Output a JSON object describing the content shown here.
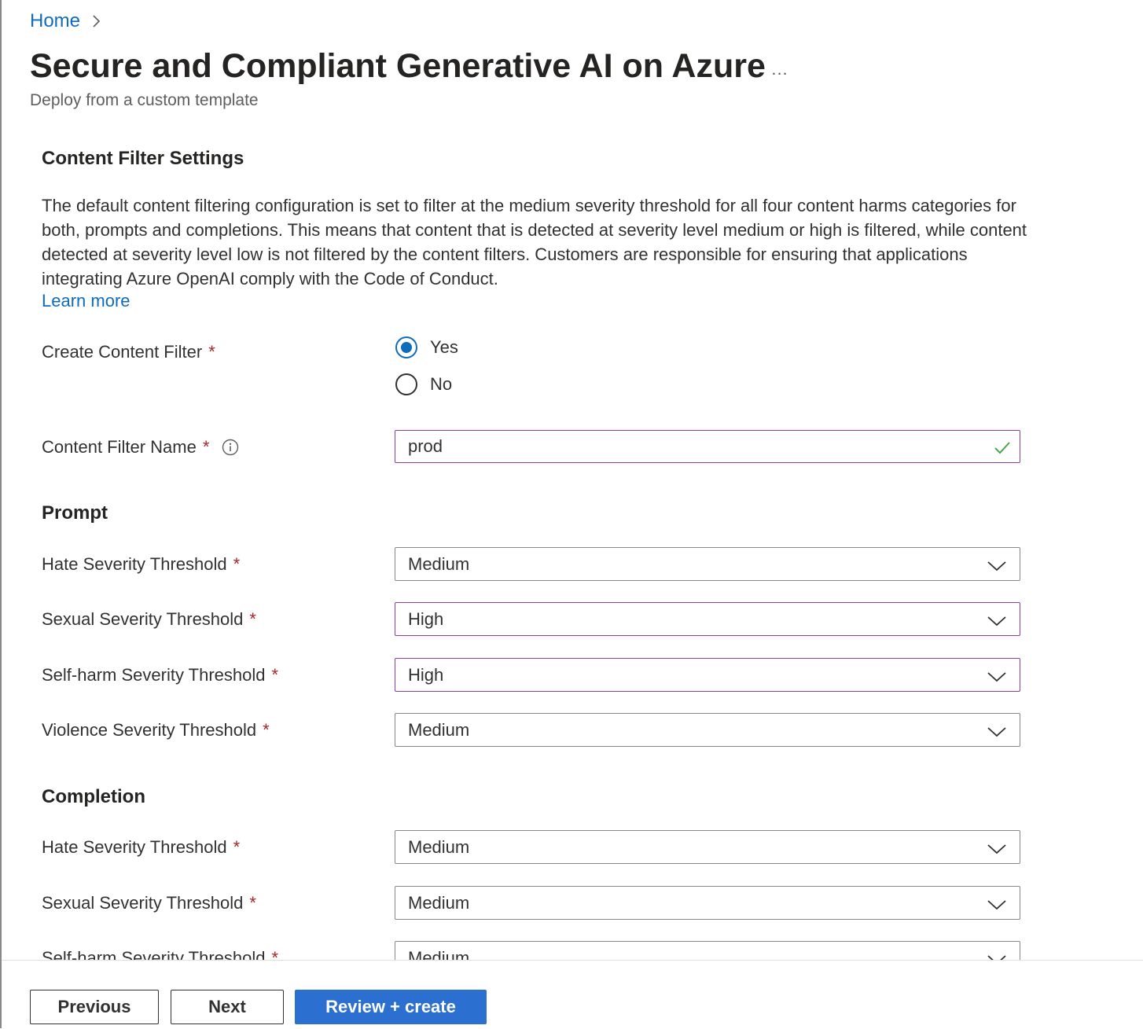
{
  "breadcrumb": {
    "home_label": "Home"
  },
  "header": {
    "title": "Secure and Compliant Generative AI on Azure",
    "more_label": "...",
    "subtitle": "Deploy from a custom template"
  },
  "content_filter": {
    "section_title": "Content Filter Settings",
    "description": "The default content filtering configuration is set to filter at the medium severity threshold for all four content harms categories for both, prompts and completions. This means that content that is detected at severity level medium or high is filtered, while content detected at severity level low is not filtered by the content filters. Customers are responsible for ensuring that applications integrating Azure OpenAI comply with the Code of Conduct.",
    "learn_more": "Learn more",
    "create_label": "Create Content Filter",
    "required_mark": "*",
    "options": {
      "yes": "Yes",
      "no": "No"
    },
    "selected": "Yes",
    "name_label": "Content Filter Name",
    "name_value": "prod"
  },
  "prompt": {
    "title": "Prompt",
    "hate": {
      "label": "Hate Severity Threshold",
      "value": "Medium"
    },
    "sexual": {
      "label": "Sexual Severity Threshold",
      "value": "High"
    },
    "selfharm": {
      "label": "Self-harm Severity Threshold",
      "value": "High"
    },
    "violence": {
      "label": "Violence Severity Threshold",
      "value": "Medium"
    }
  },
  "completion": {
    "title": "Completion",
    "hate": {
      "label": "Hate Severity Threshold",
      "value": "Medium"
    },
    "sexual": {
      "label": "Sexual Severity Threshold",
      "value": "Medium"
    },
    "selfharm": {
      "label": "Self-harm Severity Threshold",
      "value": "Medium"
    }
  },
  "footer": {
    "previous": "Previous",
    "next": "Next",
    "review_create": "Review + create"
  },
  "colors": {
    "link": "#0f6cbd",
    "required": "#a4262c",
    "focus_border": "#8a3fa3",
    "valid_check": "#4aa54a",
    "primary_button": "#2b6fd0"
  }
}
